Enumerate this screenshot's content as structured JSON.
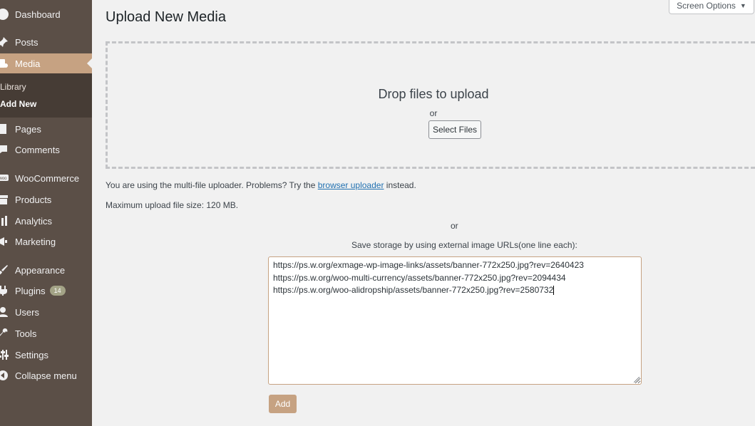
{
  "sidebar": {
    "items": [
      {
        "label": "Dashboard",
        "icon": "dashboard-icon"
      },
      {
        "label": "Posts",
        "icon": "pushpin-icon"
      },
      {
        "label": "Media",
        "icon": "media-icon",
        "active": true
      },
      {
        "label": "Pages",
        "icon": "page-icon"
      },
      {
        "label": "Comments",
        "icon": "comment-icon"
      },
      {
        "label": "WooCommerce",
        "icon": "woo-icon"
      },
      {
        "label": "Products",
        "icon": "archive-icon"
      },
      {
        "label": "Analytics",
        "icon": "chart-bars-icon"
      },
      {
        "label": "Marketing",
        "icon": "megaphone-icon"
      },
      {
        "label": "Appearance",
        "icon": "brush-icon"
      },
      {
        "label": "Plugins",
        "icon": "plugin-icon",
        "badge": "14"
      },
      {
        "label": "Users",
        "icon": "user-icon"
      },
      {
        "label": "Tools",
        "icon": "wrench-icon"
      },
      {
        "label": "Settings",
        "icon": "sliders-icon"
      },
      {
        "label": "Collapse menu",
        "icon": "collapse-icon"
      }
    ],
    "submenu": [
      {
        "label": "Library"
      },
      {
        "label": "Add New",
        "current": true
      }
    ],
    "colors": {
      "background": "#5b4f47",
      "active": "#c6a282",
      "submenu": "#463c35"
    }
  },
  "header": {
    "title": "Upload New Media",
    "screen_options": "Screen Options"
  },
  "dropzone": {
    "title": "Drop files to upload",
    "or": "or",
    "select_files": "Select Files"
  },
  "uploader_note": {
    "prefix": "You are using the multi-file uploader. Problems? Try the ",
    "link": "browser uploader",
    "suffix": " instead."
  },
  "max_size": "Maximum upload file size: 120 MB.",
  "external": {
    "or": "or",
    "label": "Save storage by using external image URLs(one line each):",
    "urls": [
      "https://ps.w.org/exmage-wp-image-links/assets/banner-772x250.jpg?rev=2640423",
      "https://ps.w.org/woo-multi-currency/assets/banner-772x250.jpg?rev=2094434",
      "https://ps.w.org/woo-alidropship/assets/banner-772x250.jpg?rev=2580732"
    ],
    "add_label": "Add"
  }
}
